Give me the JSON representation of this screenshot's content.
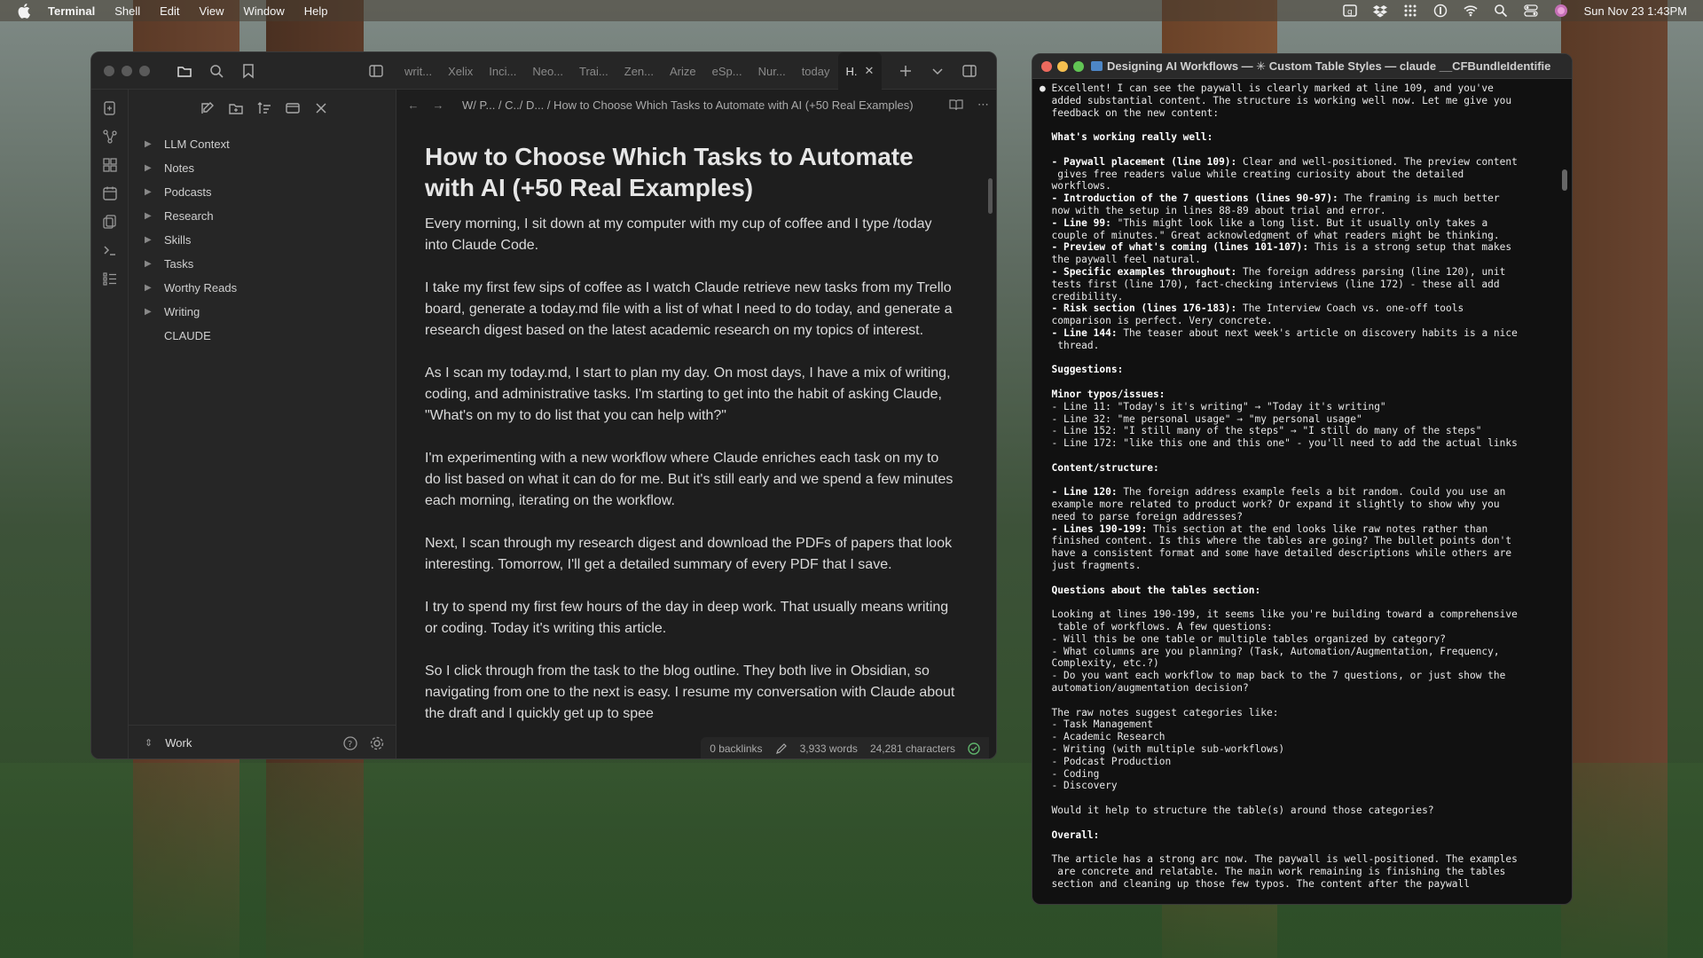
{
  "menubar": {
    "app_name": "Terminal",
    "items": [
      "Shell",
      "Edit",
      "View",
      "Window",
      "Help"
    ],
    "clock": "Sun Nov 23  1:43PM"
  },
  "obsidian": {
    "tabs": [
      "writ...",
      "Xelix",
      "Inci...",
      "Neo...",
      "Trai...",
      "Zen...",
      "Arize",
      "eSp...",
      "Nur...",
      "today",
      "H."
    ],
    "tree": [
      {
        "label": "LLM Context",
        "type": "folder"
      },
      {
        "label": "Notes",
        "type": "folder"
      },
      {
        "label": "Podcasts",
        "type": "folder"
      },
      {
        "label": "Research",
        "type": "folder"
      },
      {
        "label": "Skills",
        "type": "folder"
      },
      {
        "label": "Tasks",
        "type": "folder"
      },
      {
        "label": "Worthy Reads",
        "type": "folder"
      },
      {
        "label": "Writing",
        "type": "folder"
      },
      {
        "label": "CLAUDE",
        "type": "file"
      }
    ],
    "vault_name": "Work",
    "breadcrumb": "W/ P... / C../ D... / How to Choose Which Tasks to Automate with AI (+50 Real Examples)",
    "note": {
      "title": "How to Choose Which Tasks to Automate with AI (+50 Real Examples)",
      "paragraphs": [
        "Every morning, I sit down at my computer with my cup of coffee and I type /today into Claude Code.",
        "I take my first few sips of coffee as I watch Claude retrieve new tasks from my Trello board, generate a today.md file with a list of what I need to do today, and generate a research digest based on the latest academic research on my topics of interest.",
        "As I scan my today.md, I start to plan my day. On most days, I have a mix of writing, coding, and administrative tasks. I'm starting to get into the habit of asking Claude, \"What's on my to do list that you can help with?\"",
        "I'm experimenting with a new workflow where Claude enriches each task on my to do list based on what it can do for me. But it's still early and we spend a few minutes each morning, iterating on the workflow.",
        "Next, I scan through my research digest and download the PDFs of papers that look interesting. Tomorrow, I'll get a detailed summary of every PDF that I save.",
        "I try to spend my first few hours of the day in deep work. That usually means writing or coding. Today it's writing this article.",
        "So I click through from the task to the blog outline. They both live in Obsidian, so navigating from one to the next is easy. I resume my conversation with Claude about the draft and I quickly get up to spee"
      ]
    },
    "status": {
      "backlinks": "0 backlinks",
      "words": "3,933 words",
      "characters": "24,281 characters"
    }
  },
  "terminal": {
    "title": "Designing AI Workflows — ✳ Custom Table Styles — claude __CFBundleIdentifier...",
    "lines": [
      {
        "t": "● Excellent! I can see the paywall is clearly marked at line 109, and you've"
      },
      {
        "t": "  added substantial content. The structure is working well now. Let me give you"
      },
      {
        "t": "  feedback on the new content:"
      },
      {
        "t": ""
      },
      {
        "b": "  What's working really well:"
      },
      {
        "t": ""
      },
      {
        "b": "  - Paywall placement (line 109):",
        "t": " Clear and well-positioned. The preview content"
      },
      {
        "t": "   gives free readers value while creating curiosity about the detailed"
      },
      {
        "t": "  workflows."
      },
      {
        "b": "  - Introduction of the 7 questions (lines 90-97):",
        "t": " The framing is much better"
      },
      {
        "t": "  now with the setup in lines 88-89 about trial and error."
      },
      {
        "b": "  - Line 99:",
        "t": " \"This might look like a long list. But it usually only takes a"
      },
      {
        "t": "  couple of minutes.\" Great acknowledgment of what readers might be thinking."
      },
      {
        "b": "  - Preview of what's coming (lines 101-107):",
        "t": " This is a strong setup that makes"
      },
      {
        "t": "  the paywall feel natural."
      },
      {
        "b": "  - Specific examples throughout:",
        "t": " The foreign address parsing (line 120), unit"
      },
      {
        "t": "  tests first (line 170), fact-checking interviews (line 172) - these all add"
      },
      {
        "t": "  credibility."
      },
      {
        "b": "  - Risk section (lines 176-183):",
        "t": " The Interview Coach vs. one-off tools"
      },
      {
        "t": "  comparison is perfect. Very concrete."
      },
      {
        "b": "  - Line 144:",
        "t": " The teaser about next week's article on discovery habits is a nice"
      },
      {
        "t": "   thread."
      },
      {
        "t": ""
      },
      {
        "b": "  Suggestions:"
      },
      {
        "t": ""
      },
      {
        "b": "  Minor typos/issues:"
      },
      {
        "t": "  - Line 11: \"Today's it's writing\" → \"Today it's writing\""
      },
      {
        "t": "  - Line 32: \"me personal usage\" → \"my personal usage\""
      },
      {
        "t": "  - Line 152: \"I still many of the steps\" → \"I still do many of the steps\""
      },
      {
        "t": "  - Line 172: \"like this one and this one\" - you'll need to add the actual links"
      },
      {
        "t": ""
      },
      {
        "b": "  Content/structure:"
      },
      {
        "t": ""
      },
      {
        "b": "  - Line 120:",
        "t": " The foreign address example feels a bit random. Could you use an"
      },
      {
        "t": "  example more related to product work? Or expand it slightly to show why you"
      },
      {
        "t": "  need to parse foreign addresses?"
      },
      {
        "b": "  - Lines 190-199:",
        "t": " This section at the end looks like raw notes rather than"
      },
      {
        "t": "  finished content. Is this where the tables are going? The bullet points don't"
      },
      {
        "t": "  have a consistent format and some have detailed descriptions while others are"
      },
      {
        "t": "  just fragments."
      },
      {
        "t": ""
      },
      {
        "b": "  Questions about the tables section:"
      },
      {
        "t": ""
      },
      {
        "t": "  Looking at lines 190-199, it seems like you're building toward a comprehensive"
      },
      {
        "t": "   table of workflows. A few questions:"
      },
      {
        "t": "  - Will this be one table or multiple tables organized by category?"
      },
      {
        "t": "  - What columns are you planning? (Task, Automation/Augmentation, Frequency,"
      },
      {
        "t": "  Complexity, etc.?)"
      },
      {
        "t": "  - Do you want each workflow to map back to the 7 questions, or just show the"
      },
      {
        "t": "  automation/augmentation decision?"
      },
      {
        "t": ""
      },
      {
        "t": "  The raw notes suggest categories like:"
      },
      {
        "t": "  - Task Management"
      },
      {
        "t": "  - Academic Research"
      },
      {
        "t": "  - Writing (with multiple sub-workflows)"
      },
      {
        "t": "  - Podcast Production"
      },
      {
        "t": "  - Coding"
      },
      {
        "t": "  - Discovery"
      },
      {
        "t": ""
      },
      {
        "t": "  Would it help to structure the table(s) around those categories?"
      },
      {
        "t": ""
      },
      {
        "b": "  Overall:"
      },
      {
        "t": ""
      },
      {
        "t": "  The article has a strong arc now. The paywall is well-positioned. The examples"
      },
      {
        "t": "   are concrete and relatable. The main work remaining is finishing the tables"
      },
      {
        "t": "  section and cleaning up those few typos. The content after the paywall"
      }
    ]
  }
}
